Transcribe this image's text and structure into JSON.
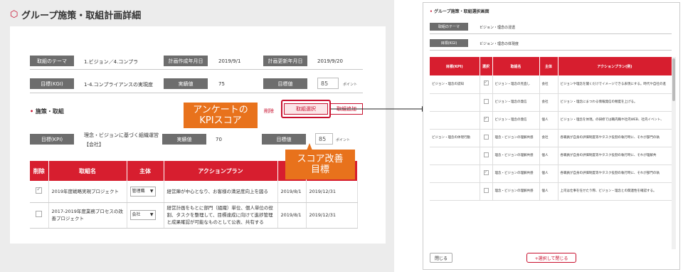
{
  "left": {
    "title": "グループ施策・取組計画詳細",
    "theme_label": "取組のテーマ",
    "theme_value": "1.ビジョン／4.コンプラ",
    "created_label": "計画作成年月日",
    "created_value": "2019/9/1",
    "updated_label": "計画更新年月日",
    "updated_value": "2019/9/20",
    "kgi_label": "目標(KGI)",
    "kgi_value": "1-4.コンプライアンスの実現度",
    "actual_label": "実績値",
    "actual_value": "75",
    "target_label": "目標値",
    "target_value": "85",
    "point_unit": "ポイント",
    "section_title": "施策・取組",
    "delete_label": "削除",
    "select_button": "取組選択",
    "add_button": "取組追加",
    "kpi_label": "目標(KPI)",
    "kpi_value_line1": "理念・ビジョンに基づく組織運営",
    "kpi_value_line2": "【会社】",
    "kpi_actual_label": "実績値",
    "kpi_actual_value": "70",
    "kpi_target_label": "目標値",
    "kpi_target_value": "85",
    "kpi_point_unit": "ポイント",
    "callout_kpi_line1": "アンケートの",
    "callout_kpi_line2": "KPIスコア",
    "callout_goal_line1": "スコア改善",
    "callout_goal_line2": "目標",
    "table": {
      "headers": [
        "削除",
        "取組名",
        "主体",
        "アクションプラン",
        "",
        ""
      ],
      "rows": [
        {
          "checked": true,
          "name": "2019年度戦略実現プロジェクト",
          "actor": "管理職",
          "plan": "経営陣が中心となり、お客様の満足度向上を図る",
          "start": "2019/8/1",
          "end": "2019/12/31"
        },
        {
          "checked": false,
          "name": "2017-2019年度業務プロセスの改善プロジェクト",
          "actor": "会社",
          "plan": "経営計画をもとに部門（組織）単位、個人単位の役割、タスクを整理して、目標達成に向けて進捗管理と成果確認が可能なものとして公表、共有する",
          "start": "2019/8/1",
          "end": "2019/12/31"
        }
      ]
    }
  },
  "right": {
    "title": "グループ施策・取組選択画面",
    "theme_label": "取組のテーマ",
    "theme_value": "ビジョン・理念の浸透",
    "goal_label": "目標(KGI)",
    "goal_value": "ビジョン・理念の体現度",
    "headers": [
      "目標(KPI)",
      "選択",
      "取組名",
      "主体",
      "アクションプラン(例)"
    ],
    "rows": [
      {
        "kpi": "ビジョン・理念の認知",
        "checked": true,
        "name": "ビジョン・理念の見直し",
        "actor": "会社",
        "plan": "ビジョンや理念を聞くだけでイメージできる表現にする。時代や自社の進"
      },
      {
        "kpi": "",
        "checked": false,
        "name": "ビジョン・理念の発信",
        "actor": "会社",
        "plan": "ビジョン・理念にまつわる情報発信の頻度を上げる。"
      },
      {
        "kpi": "",
        "checked": true,
        "name": "ビジョン・理念の発信",
        "actor": "個人",
        "plan": "ビジョン・理念を体現。の研修では職内職や社内WEB、社内イベント、"
      },
      {
        "kpi": "ビジョン・理念の体現行動",
        "checked": false,
        "name": "理念・ビジョンの理解共感",
        "actor": "会社",
        "plan": "各職員が自身の評価制度等やタスク役割の執行時に、それが部門の執"
      },
      {
        "kpi": "",
        "checked": false,
        "name": "理念・ビジョンの理解共感",
        "actor": "個人",
        "plan": "各職員が自身の評価制度等やタスク役割の執行時に、それが理解共"
      },
      {
        "kpi": "",
        "checked": true,
        "name": "理念・ビジョンの理解共感",
        "actor": "個人",
        "plan": "各職員が自身の評価制度等やタスク役割の執行時に、それが部門の執"
      },
      {
        "kpi": "",
        "checked": false,
        "name": "理念・ビジョンの理解共感",
        "actor": "個人",
        "plan": "上司は仕事を任せたり際、ビジョン・理念との関連性を確認する。"
      }
    ],
    "close_button": "閉じる",
    "select_close_button": "+選択して閉じる"
  },
  "colors": {
    "accent": "#d71e2f",
    "callout": "#e8721c",
    "label_bg": "#6d6d6d"
  }
}
